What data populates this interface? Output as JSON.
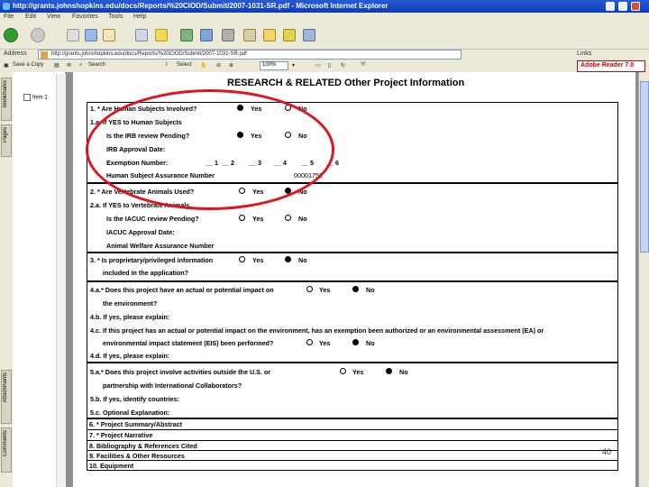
{
  "window": {
    "title": "http://grants.johnshopkins.edu/docs/Reports/%20CIOD/Submit/2007-1031-SR.pdf - Microsoft Internet Explorer"
  },
  "menu": [
    "File",
    "Edit",
    "View",
    "Favorites",
    "Tools",
    "Help"
  ],
  "address": {
    "label": "Address",
    "url": "http://grants.johnshopkins.edu/docs/Reports/%20CIOD/Submit/2007-1031-SR.pdf",
    "links_label": "Links"
  },
  "acrobat": {
    "save_copy": "Save a Copy",
    "select": "Select",
    "zoom": "100%",
    "search": "Search",
    "adobe_reader": "Adobe Reader 7.0"
  },
  "sidebar": {
    "tabs": [
      "Bookmarks",
      "Pages",
      "Attachments",
      "Comments"
    ],
    "bookmark_item": "Item 1"
  },
  "document": {
    "title": "RESEARCH & RELATED Other Project Information",
    "page_number": "40",
    "q1": "1.   * Are Human Subjects Involved?",
    "q1a": "1.a. If YES to Human Subjects",
    "q1a_irb": "Is the IRB review Pending?",
    "irb_date": "IRB Approval Date:",
    "exemption": "Exemption Number:",
    "exemption_opts": [
      "1",
      "2",
      "3",
      "4",
      "5",
      "6"
    ],
    "hsa": "Human Subject Assurance Number",
    "hsa_value": "00001752",
    "q2": "2.   * Are Vertebrate Animals Used?",
    "q2a": "2.a. If YES to Vertebrate Animals",
    "q2a_iacuc": "Is the IACUC review Pending?",
    "iacuc_date": "IACUC Approval Date:",
    "animal_welfare": "Animal Welfare Assurance Number",
    "q3": "3.   * Is proprietary/privileged information",
    "q3b": "included in the application?",
    "q4a": "4.a.* Does this project have an actual or potential impact on",
    "q4a_2": "the environment?",
    "q4b": "4.b. If yes, please explain:",
    "q4c": "4.c. If this project has an actual or potential impact on the environment, has an exemption been authorized or an environmental assessment (EA) or",
    "q4c_2": "environmental impact statement (EIS) been performed?",
    "q4d": "4.d. If yes, please explain:",
    "q5a": "5.a.* Does this project involve activities outside the U.S. or",
    "q5a_2": "partnership with International Collaborators?",
    "q5b": "5.b. If yes, identify countries:",
    "q5c": "5.c. Optional Explanation:",
    "yes": "Yes",
    "no": "No",
    "list": [
      "6.   * Project Summary/Abstract",
      "7.   * Project Narrative",
      "8.   Bibliography & References Cited",
      "9.   Facilities & Other Resources",
      "10.  Equipment"
    ]
  },
  "colors": {
    "annotation_circle": "#e0141e",
    "titlebar": "#0b3cb8"
  }
}
